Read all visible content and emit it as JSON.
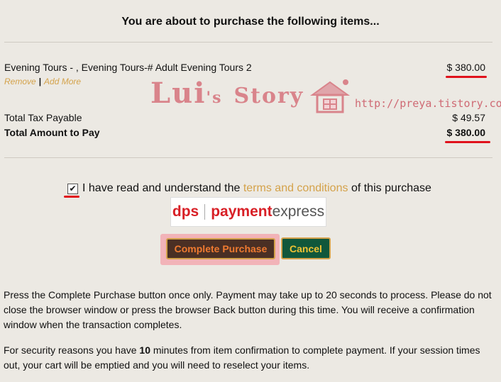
{
  "header": {
    "title": "You are about to purchase the following items..."
  },
  "item": {
    "name": "Evening Tours - , Evening Tours-# Adult Evening Tours 2",
    "price": "$ 380.00",
    "remove_label": "Remove",
    "separator": "|",
    "add_more_label": "Add More"
  },
  "totals": {
    "tax_label": "Total Tax Payable",
    "tax_value": "$ 49.57",
    "total_label": "Total Amount to Pay",
    "total_value": "$ 380.00"
  },
  "watermark": {
    "text_main": "Lui",
    "text_apos": "'s",
    "text_story": "Story",
    "url": "http://preya.tistory.com"
  },
  "agreement": {
    "checked": true,
    "prefix": "I have read and understand the",
    "link": "terms and conditions",
    "suffix": "of this purchase"
  },
  "logo": {
    "brand": "dps",
    "name_payment": "payment",
    "name_express": "express"
  },
  "buttons": {
    "complete": "Complete Purchase",
    "cancel": "Cancel"
  },
  "notes": {
    "p1": "Press the Complete Purchase button once only. Payment may take up to 20 seconds to process. Please do not close the browser window or press the browser Back button during this time. You will receive a confirmation window when the transaction completes.",
    "p2_before": "For security reasons you have ",
    "p2_minutes": "10",
    "p2_after": " minutes from item confirmation to complete payment. If your session times out, your cart will be emptied and you will need to reselect your items."
  },
  "colors": {
    "accent": "#d4a24a",
    "annotation_red": "#e0121c",
    "purchase_bg": "#4a2f24",
    "cancel_bg": "#10573b"
  }
}
